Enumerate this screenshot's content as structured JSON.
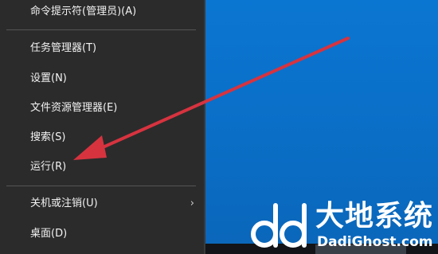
{
  "context_menu": {
    "items": [
      {
        "label": "命令提示符(管理员)(A)"
      },
      {
        "label": "任务管理器(T)"
      },
      {
        "label": "设置(N)"
      },
      {
        "label": "文件资源管理器(E)"
      },
      {
        "label": "搜索(S)"
      },
      {
        "label": "运行(R)"
      },
      {
        "label": "关机或注销(U)",
        "submenu_glyph": "›"
      },
      {
        "label": "桌面(D)"
      }
    ]
  },
  "annotation": {
    "arrow_color": "#d7333f",
    "points_to": "运行(R)"
  },
  "watermark": {
    "brand_title": "大地系统",
    "brand_domain": "DadiGhost.com",
    "logo_icon": "dd-logo-icon"
  },
  "colors": {
    "menu_bg": "#2b2b2b",
    "desktop_blue": "#0a72c9",
    "menu_text": "#f2f2f2"
  }
}
